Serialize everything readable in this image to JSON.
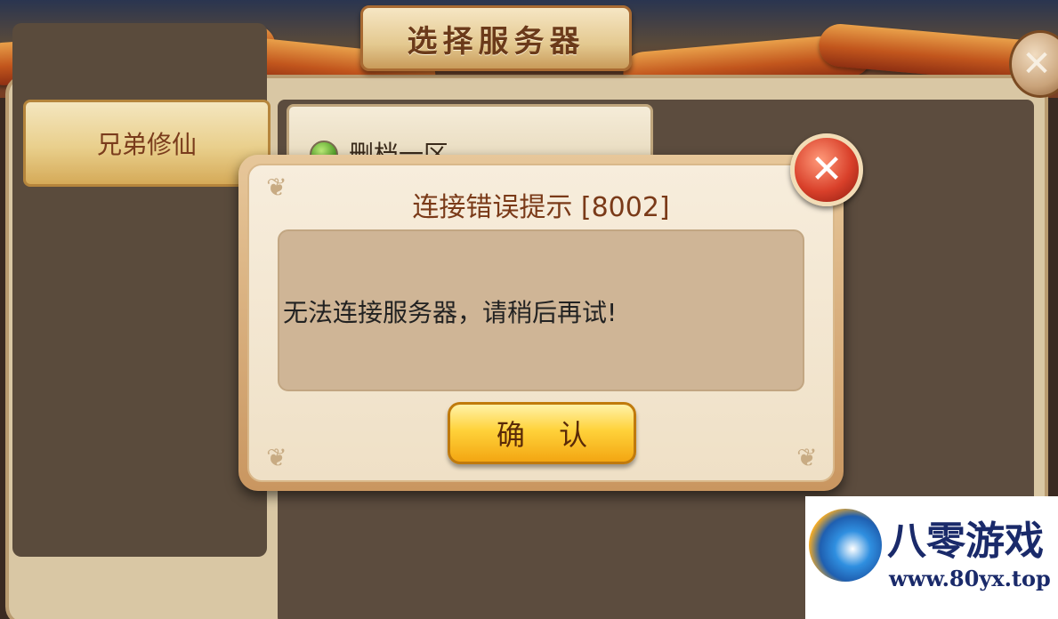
{
  "window": {
    "title": "选择服务器"
  },
  "sidebar": {
    "items": [
      {
        "label": "兄弟修仙",
        "selected": true
      }
    ]
  },
  "server_list": {
    "items": [
      {
        "label": "删档一区",
        "status_color": "#4a9a22"
      }
    ]
  },
  "dialog": {
    "title": "连接错误提示 [8002]",
    "message": "无法连接服务器，请稍后再试!",
    "confirm_label": "确 认",
    "close_icon": "close-icon"
  },
  "watermark": {
    "title": "八零游戏",
    "url": "www.80yx.top"
  },
  "colors": {
    "accent": "#ffd23a",
    "title_text": "#7a3a18",
    "close_red": "#d9402a"
  }
}
